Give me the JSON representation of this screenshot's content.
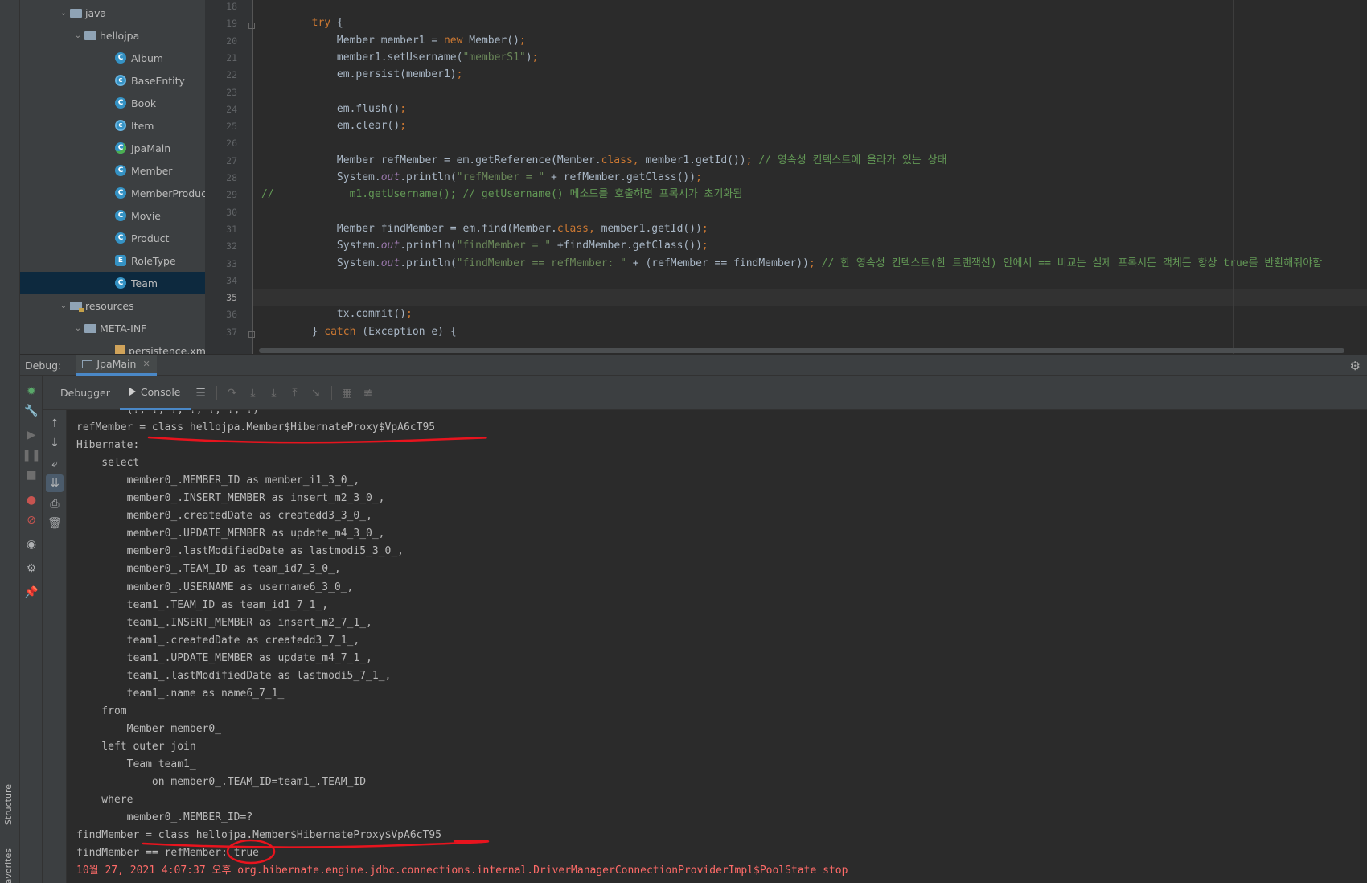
{
  "left_strip": {
    "structure_label": "Structure",
    "favorites_label": "avorites"
  },
  "project_tree": {
    "items": [
      {
        "label": "java",
        "kind": "folder",
        "depth": 1,
        "expanded": true
      },
      {
        "label": "hellojpa",
        "kind": "folder",
        "depth": 2,
        "expanded": true
      },
      {
        "label": "Album",
        "kind": "class",
        "depth": 3
      },
      {
        "label": "BaseEntity",
        "kind": "abstract",
        "depth": 3
      },
      {
        "label": "Book",
        "kind": "class",
        "depth": 3
      },
      {
        "label": "Item",
        "kind": "abstract",
        "depth": 3
      },
      {
        "label": "JpaMain",
        "kind": "main",
        "depth": 3
      },
      {
        "label": "Member",
        "kind": "class",
        "depth": 3
      },
      {
        "label": "MemberProduct",
        "kind": "class",
        "depth": 3
      },
      {
        "label": "Movie",
        "kind": "class",
        "depth": 3
      },
      {
        "label": "Product",
        "kind": "class",
        "depth": 3
      },
      {
        "label": "RoleType",
        "kind": "enum",
        "depth": 3
      },
      {
        "label": "Team",
        "kind": "class",
        "depth": 3,
        "selected": true
      },
      {
        "label": "resources",
        "kind": "res-folder",
        "depth": 1,
        "expanded": true
      },
      {
        "label": "META-INF",
        "kind": "folder",
        "depth": 2,
        "expanded": true
      },
      {
        "label": "persistence.xml",
        "kind": "xml",
        "depth": 3
      }
    ]
  },
  "editor": {
    "current_line": "35",
    "lines": [
      {
        "no": "18",
        "tokens": []
      },
      {
        "no": "19",
        "tokens": [
          [
            "kw",
            "        try "
          ],
          [
            "",
            "{"
          ]
        ]
      },
      {
        "no": "20",
        "tokens": [
          [
            "",
            "            Member member1 = "
          ],
          [
            "kw",
            "new "
          ],
          [
            "",
            "Member()"
          ],
          [
            "kw",
            ";"
          ]
        ]
      },
      {
        "no": "21",
        "tokens": [
          [
            "",
            "            member1.setUsername("
          ],
          [
            "str",
            "\"memberS1\""
          ],
          [
            "",
            ")"
          ],
          [
            "kw",
            ";"
          ]
        ]
      },
      {
        "no": "22",
        "tokens": [
          [
            "",
            "            em.persist(member1)"
          ],
          [
            "kw",
            ";"
          ]
        ]
      },
      {
        "no": "23",
        "tokens": []
      },
      {
        "no": "24",
        "tokens": [
          [
            "",
            "            em.flush()"
          ],
          [
            "kw",
            ";"
          ]
        ]
      },
      {
        "no": "25",
        "tokens": [
          [
            "",
            "            em.clear()"
          ],
          [
            "kw",
            ";"
          ]
        ]
      },
      {
        "no": "26",
        "tokens": []
      },
      {
        "no": "27",
        "tokens": [
          [
            "",
            "            Member refMember = em.getReference(Member."
          ],
          [
            "kw",
            "class"
          ],
          [
            "kw",
            ", "
          ],
          [
            "",
            "member1.getId())"
          ],
          [
            "kw",
            "; "
          ],
          [
            "cmt",
            "// 영속성 컨텍스트에 올라가 있는 상태"
          ]
        ]
      },
      {
        "no": "28",
        "tokens": [
          [
            "",
            "            System."
          ],
          [
            "fld",
            "out"
          ],
          [
            "",
            ".println("
          ],
          [
            "str",
            "\"refMember = \""
          ],
          [
            "",
            " + refMember.getClass())"
          ],
          [
            "kw",
            ";"
          ]
        ]
      },
      {
        "no": "29",
        "tokens": [
          [
            "cmt",
            "//            m1.getUsername(); // getUsername() 메소드를 호출하면 프록시가 초기화됨"
          ]
        ]
      },
      {
        "no": "30",
        "tokens": []
      },
      {
        "no": "31",
        "tokens": [
          [
            "",
            "            Member findMember = em.find(Member."
          ],
          [
            "kw",
            "class"
          ],
          [
            "kw",
            ", "
          ],
          [
            "",
            "member1.getId())"
          ],
          [
            "kw",
            ";"
          ]
        ]
      },
      {
        "no": "32",
        "tokens": [
          [
            "",
            "            System."
          ],
          [
            "fld",
            "out"
          ],
          [
            "",
            ".println("
          ],
          [
            "str",
            "\"findMember = \""
          ],
          [
            "",
            " +findMember.getClass())"
          ],
          [
            "kw",
            ";"
          ]
        ]
      },
      {
        "no": "33",
        "tokens": [
          [
            "",
            "            System."
          ],
          [
            "fld",
            "out"
          ],
          [
            "",
            ".println("
          ],
          [
            "str",
            "\"findMember == refMember: \""
          ],
          [
            "",
            " + (refMember == findMember))"
          ],
          [
            "kw",
            "; "
          ],
          [
            "cmt",
            "// 한 영속성 컨텍스트(한 트랜잭션) 안에서 == 비교는 실제 프록시든 객체든 항상 true를 반환해줘야함"
          ]
        ]
      },
      {
        "no": "34",
        "tokens": []
      },
      {
        "no": "35",
        "tokens": []
      },
      {
        "no": "36",
        "tokens": [
          [
            "",
            "            tx.commit()"
          ],
          [
            "kw",
            ";"
          ]
        ]
      },
      {
        "no": "37",
        "tokens": [
          [
            "",
            "        } "
          ],
          [
            "kw",
            "catch "
          ],
          [
            "",
            "(Exception e) {"
          ]
        ]
      }
    ]
  },
  "debug": {
    "label": "Debug:",
    "run_config": "JpaMain",
    "tabs": [
      "Debugger",
      "Console"
    ],
    "active_tab": "Console"
  },
  "console": {
    "lines": [
      {
        "text": "        (?, ?, ?, ?, ?, ?, ?)",
        "type": "normal"
      },
      {
        "text": "refMember = class hellojpa.Member$HibernateProxy$VpA6cT95",
        "type": "normal"
      },
      {
        "text": "Hibernate: ",
        "type": "normal"
      },
      {
        "text": "    select",
        "type": "normal"
      },
      {
        "text": "        member0_.MEMBER_ID as member_i1_3_0_,",
        "type": "normal"
      },
      {
        "text": "        member0_.INSERT_MEMBER as insert_m2_3_0_,",
        "type": "normal"
      },
      {
        "text": "        member0_.createdDate as createdd3_3_0_,",
        "type": "normal"
      },
      {
        "text": "        member0_.UPDATE_MEMBER as update_m4_3_0_,",
        "type": "normal"
      },
      {
        "text": "        member0_.lastModifiedDate as lastmodi5_3_0_,",
        "type": "normal"
      },
      {
        "text": "        member0_.TEAM_ID as team_id7_3_0_,",
        "type": "normal"
      },
      {
        "text": "        member0_.USERNAME as username6_3_0_,",
        "type": "normal"
      },
      {
        "text": "        team1_.TEAM_ID as team_id1_7_1_,",
        "type": "normal"
      },
      {
        "text": "        team1_.INSERT_MEMBER as insert_m2_7_1_,",
        "type": "normal"
      },
      {
        "text": "        team1_.createdDate as createdd3_7_1_,",
        "type": "normal"
      },
      {
        "text": "        team1_.UPDATE_MEMBER as update_m4_7_1_,",
        "type": "normal"
      },
      {
        "text": "        team1_.lastModifiedDate as lastmodi5_7_1_,",
        "type": "normal"
      },
      {
        "text": "        team1_.name as name6_7_1_ ",
        "type": "normal"
      },
      {
        "text": "    from",
        "type": "normal"
      },
      {
        "text": "        Member member0_ ",
        "type": "normal"
      },
      {
        "text": "    left outer join",
        "type": "normal"
      },
      {
        "text": "        Team team1_ ",
        "type": "normal"
      },
      {
        "text": "            on member0_.TEAM_ID=team1_.TEAM_ID ",
        "type": "normal"
      },
      {
        "text": "    where",
        "type": "normal"
      },
      {
        "text": "        member0_.MEMBER_ID=?",
        "type": "normal"
      },
      {
        "text": "findMember = class hellojpa.Member$HibernateProxy$VpA6cT95",
        "type": "normal"
      },
      {
        "text": "findMember == refMember: true",
        "type": "normal"
      },
      {
        "text": "10월 27, 2021 4:07:37 오후 org.hibernate.engine.jdbc.connections.internal.DriverManagerConnectionProviderImpl$PoolState stop",
        "type": "err"
      }
    ]
  },
  "colors": {
    "annotation": "#e8141e",
    "selection": "#0d293e",
    "accent": "#4a88c7"
  }
}
